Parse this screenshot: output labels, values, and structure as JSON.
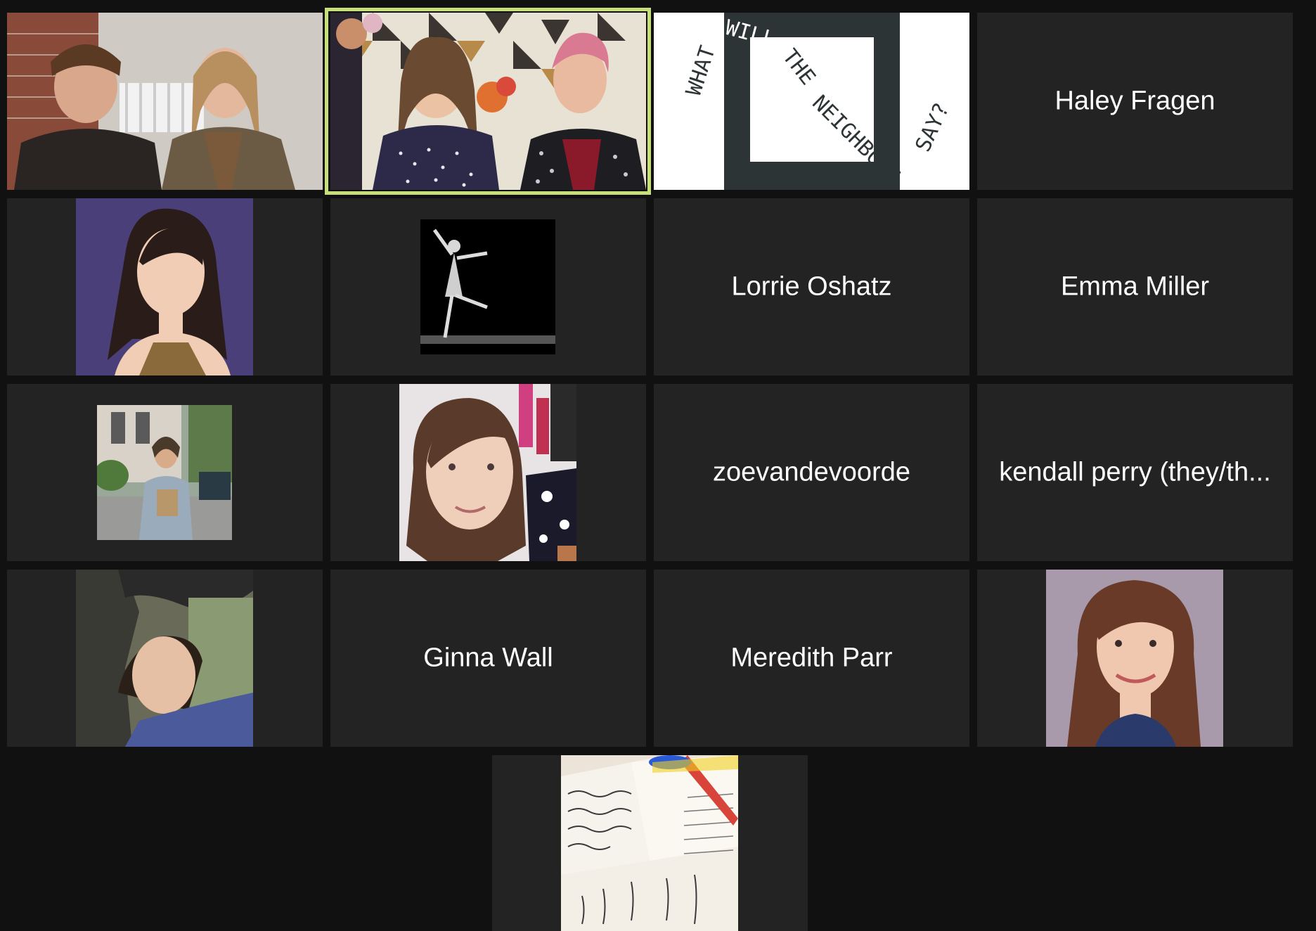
{
  "app": "Video meeting gallery view",
  "accent": {
    "active_speaker_border": "#c7e07a",
    "tile_bg": "#232323",
    "page_bg": "#111111"
  },
  "tiles": [
    {
      "type": "video",
      "subject": "two people seated by brick wall"
    },
    {
      "type": "video",
      "subject": "two performers in front of quilt",
      "active_speaker": true
    },
    {
      "type": "logo",
      "logo_text": "WHAT WILL THE NEIGHBORS SAY?"
    },
    {
      "type": "name",
      "name": "Haley Fragen"
    },
    {
      "type": "avatar",
      "subject": "headshot, purple backdrop"
    },
    {
      "type": "avatar",
      "subject": "black and white dancer"
    },
    {
      "type": "name",
      "name": "Lorrie Oshatz"
    },
    {
      "type": "name",
      "name": "Emma Miller"
    },
    {
      "type": "avatar",
      "subject": "person on street"
    },
    {
      "type": "avatar",
      "subject": "selfie"
    },
    {
      "type": "name",
      "name": "zoevandevoorde"
    },
    {
      "type": "name",
      "name": "kendall perry (they/th..."
    },
    {
      "type": "avatar",
      "subject": "person under sculpture"
    },
    {
      "type": "name",
      "name": "Ginna Wall"
    },
    {
      "type": "name",
      "name": "Meredith Parr"
    },
    {
      "type": "avatar",
      "subject": "headshot, smiling"
    },
    {
      "type": "avatar",
      "subject": "handwritten notes"
    }
  ]
}
